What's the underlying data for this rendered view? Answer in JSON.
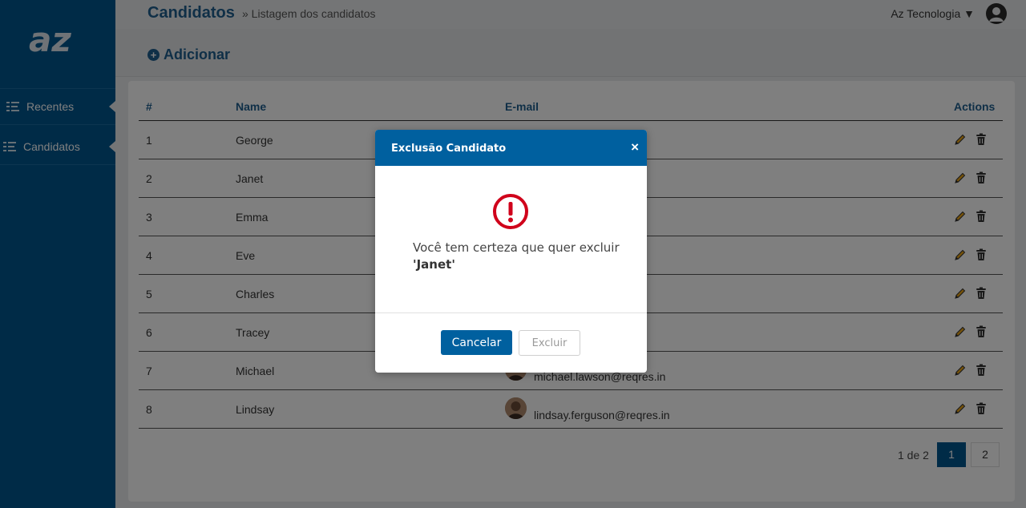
{
  "sidebar": {
    "logo_text": "az",
    "items": [
      {
        "label": "Recentes",
        "icon": "list-icon"
      },
      {
        "label": "Candidatos",
        "icon": "list-icon"
      }
    ]
  },
  "header": {
    "title": "Candidatos",
    "breadcrumb": "» Listagem dos candidatos",
    "company": "Az Tecnologia ▼"
  },
  "toolbar": {
    "add_label": "Adicionar"
  },
  "table": {
    "columns": [
      "#",
      "Name",
      "E-mail",
      "Actions"
    ],
    "rows": [
      {
        "id": "1",
        "name": "George",
        "email": ""
      },
      {
        "id": "2",
        "name": "Janet",
        "email": "n"
      },
      {
        "id": "3",
        "name": "Emma",
        "email": ""
      },
      {
        "id": "4",
        "name": "Eve",
        "email": ""
      },
      {
        "id": "5",
        "name": "Charles",
        "email": "in"
      },
      {
        "id": "6",
        "name": "Tracey",
        "email": "n"
      },
      {
        "id": "7",
        "name": "Michael",
        "email": "michael.lawson@reqres.in"
      },
      {
        "id": "8",
        "name": "Lindsay",
        "email": "lindsay.ferguson@reqres.in"
      }
    ]
  },
  "pagination": {
    "info": "1 de 2",
    "pages": [
      "1",
      "2"
    ],
    "active": "1"
  },
  "modal": {
    "title": "Exclusão Candidato",
    "close": "×",
    "message": "Você tem certeza que quer excluir",
    "target": "'Janet'",
    "cancel_label": "Cancelar",
    "delete_label": "Excluir"
  },
  "colors": {
    "primary": "#00578f",
    "modal_header": "#00609f",
    "warning": "#d0021b"
  }
}
